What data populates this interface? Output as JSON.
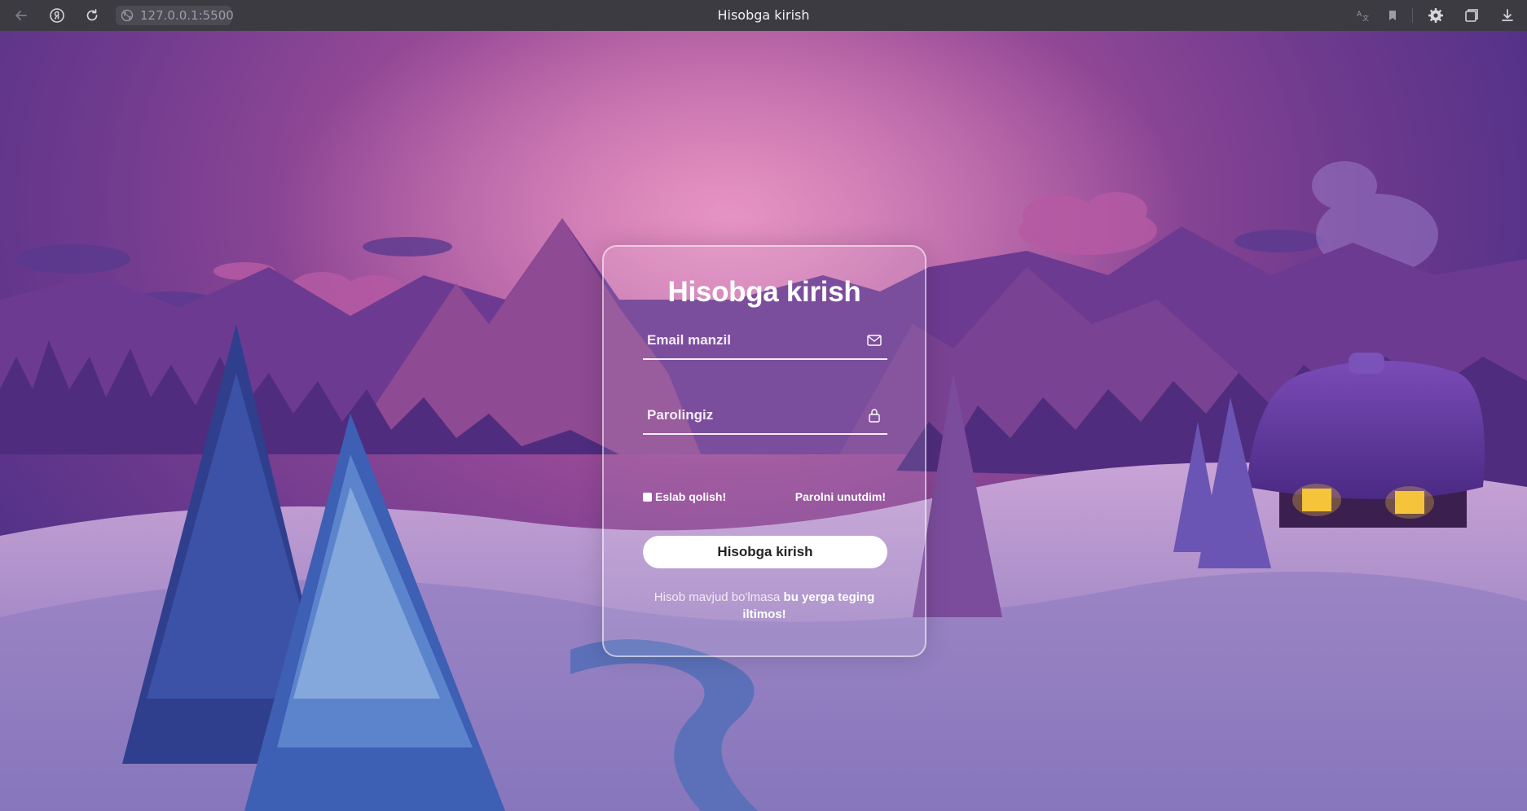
{
  "browser": {
    "url": "127.0.0.1:5500",
    "tab_title": "Hisobga kirish",
    "icons": {
      "back": "back-arrow-icon",
      "yandex": "yandex-icon",
      "reload": "reload-icon",
      "site_info": "site-info-icon",
      "translate": "translate-icon",
      "bookmark": "bookmark-icon",
      "extensions": "gear-icon",
      "collections": "collections-icon",
      "downloads": "download-icon"
    }
  },
  "login": {
    "title": "Hisobga kirish",
    "email_placeholder": "Email manzil",
    "password_placeholder": "Parolingiz",
    "remember_label": "Eslab qolish!",
    "forgot_label": "Parolni unutdim!",
    "submit_label": "Hisobga kirish",
    "register_text": "Hisob mavjud bo'lmasa",
    "register_link": "bu yerga teging iltimos!"
  },
  "colors": {
    "chrome_bg": "#3c3b42",
    "sky_top": "#c96aa8",
    "sky_bottom": "#3d2a7c",
    "card_border": "#ffffff",
    "button_bg": "#ffffff"
  }
}
